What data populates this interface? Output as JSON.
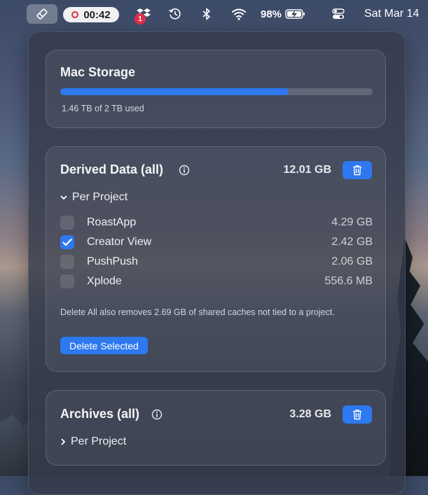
{
  "menubar": {
    "recording_time": "00:42",
    "dropbox_badge": "1",
    "battery_percent": "98%",
    "date": "Sat Mar 14"
  },
  "storage": {
    "title": "Mac Storage",
    "used_fraction": 0.73,
    "caption": "1.46 TB of 2 TB used"
  },
  "derived": {
    "title": "Derived Data (all)",
    "total": "12.01 GB",
    "disclosure_label": "Per Project",
    "expanded": true,
    "projects": [
      {
        "name": "RoastApp",
        "size": "4.29 GB",
        "checked": false
      },
      {
        "name": "Creator View",
        "size": "2.42 GB",
        "checked": true
      },
      {
        "name": "PushPush",
        "size": "2.06 GB",
        "checked": false
      },
      {
        "name": "Xplode",
        "size": "556.6 MB",
        "checked": false
      }
    ],
    "note": "Delete All also removes 2.69 GB of shared caches not tied to a project.",
    "delete_selected_label": "Delete Selected"
  },
  "archives": {
    "title": "Archives (all)",
    "total": "3.28 GB",
    "disclosure_label": "Per Project",
    "expanded": false
  },
  "colors": {
    "accent": "#2e78f0",
    "record": "#e0303a"
  }
}
